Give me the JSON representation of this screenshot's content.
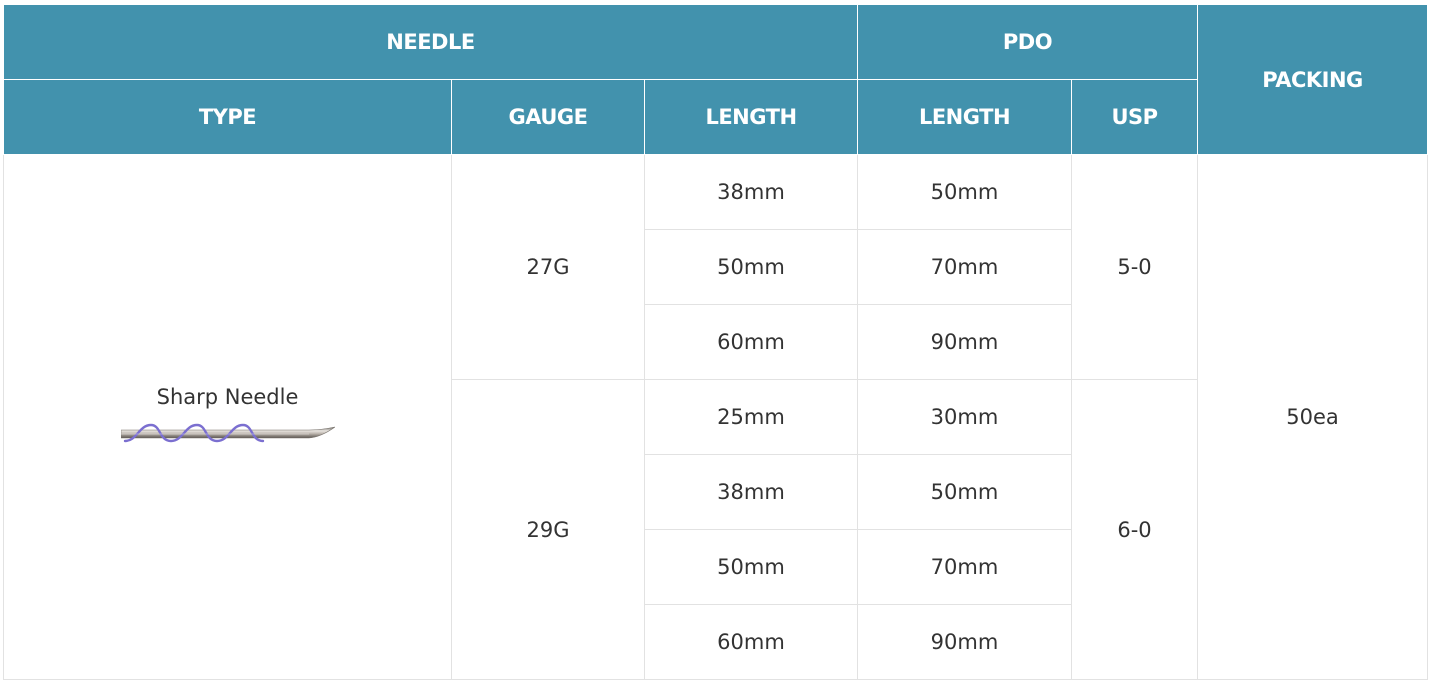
{
  "headers": {
    "needle": "NEEDLE",
    "pdo": "PDO",
    "packing": "PACKING",
    "type": "TYPE",
    "gauge": "GAUGE",
    "needle_length": "LENGTH",
    "pdo_length": "LENGTH",
    "usp": "USP"
  },
  "row": {
    "type_label": "Sharp Needle",
    "type_icon": "needle-image",
    "packing": "50ea",
    "groups": [
      {
        "gauge": "27G",
        "usp": "5-0",
        "lengths": [
          {
            "needle": "38mm",
            "pdo": "50mm"
          },
          {
            "needle": "50mm",
            "pdo": "70mm"
          },
          {
            "needle": "60mm",
            "pdo": "90mm"
          }
        ]
      },
      {
        "gauge": "29G",
        "usp": "6-0",
        "lengths": [
          {
            "needle": "25mm",
            "pdo": "30mm"
          },
          {
            "needle": "38mm",
            "pdo": "50mm"
          },
          {
            "needle": "50mm",
            "pdo": "70mm"
          },
          {
            "needle": "60mm",
            "pdo": "90mm"
          }
        ]
      }
    ]
  },
  "colors": {
    "header_bg": "#4292ad",
    "header_text": "#ffffff",
    "body_text": "#333333",
    "border": "#e2e2e2"
  }
}
